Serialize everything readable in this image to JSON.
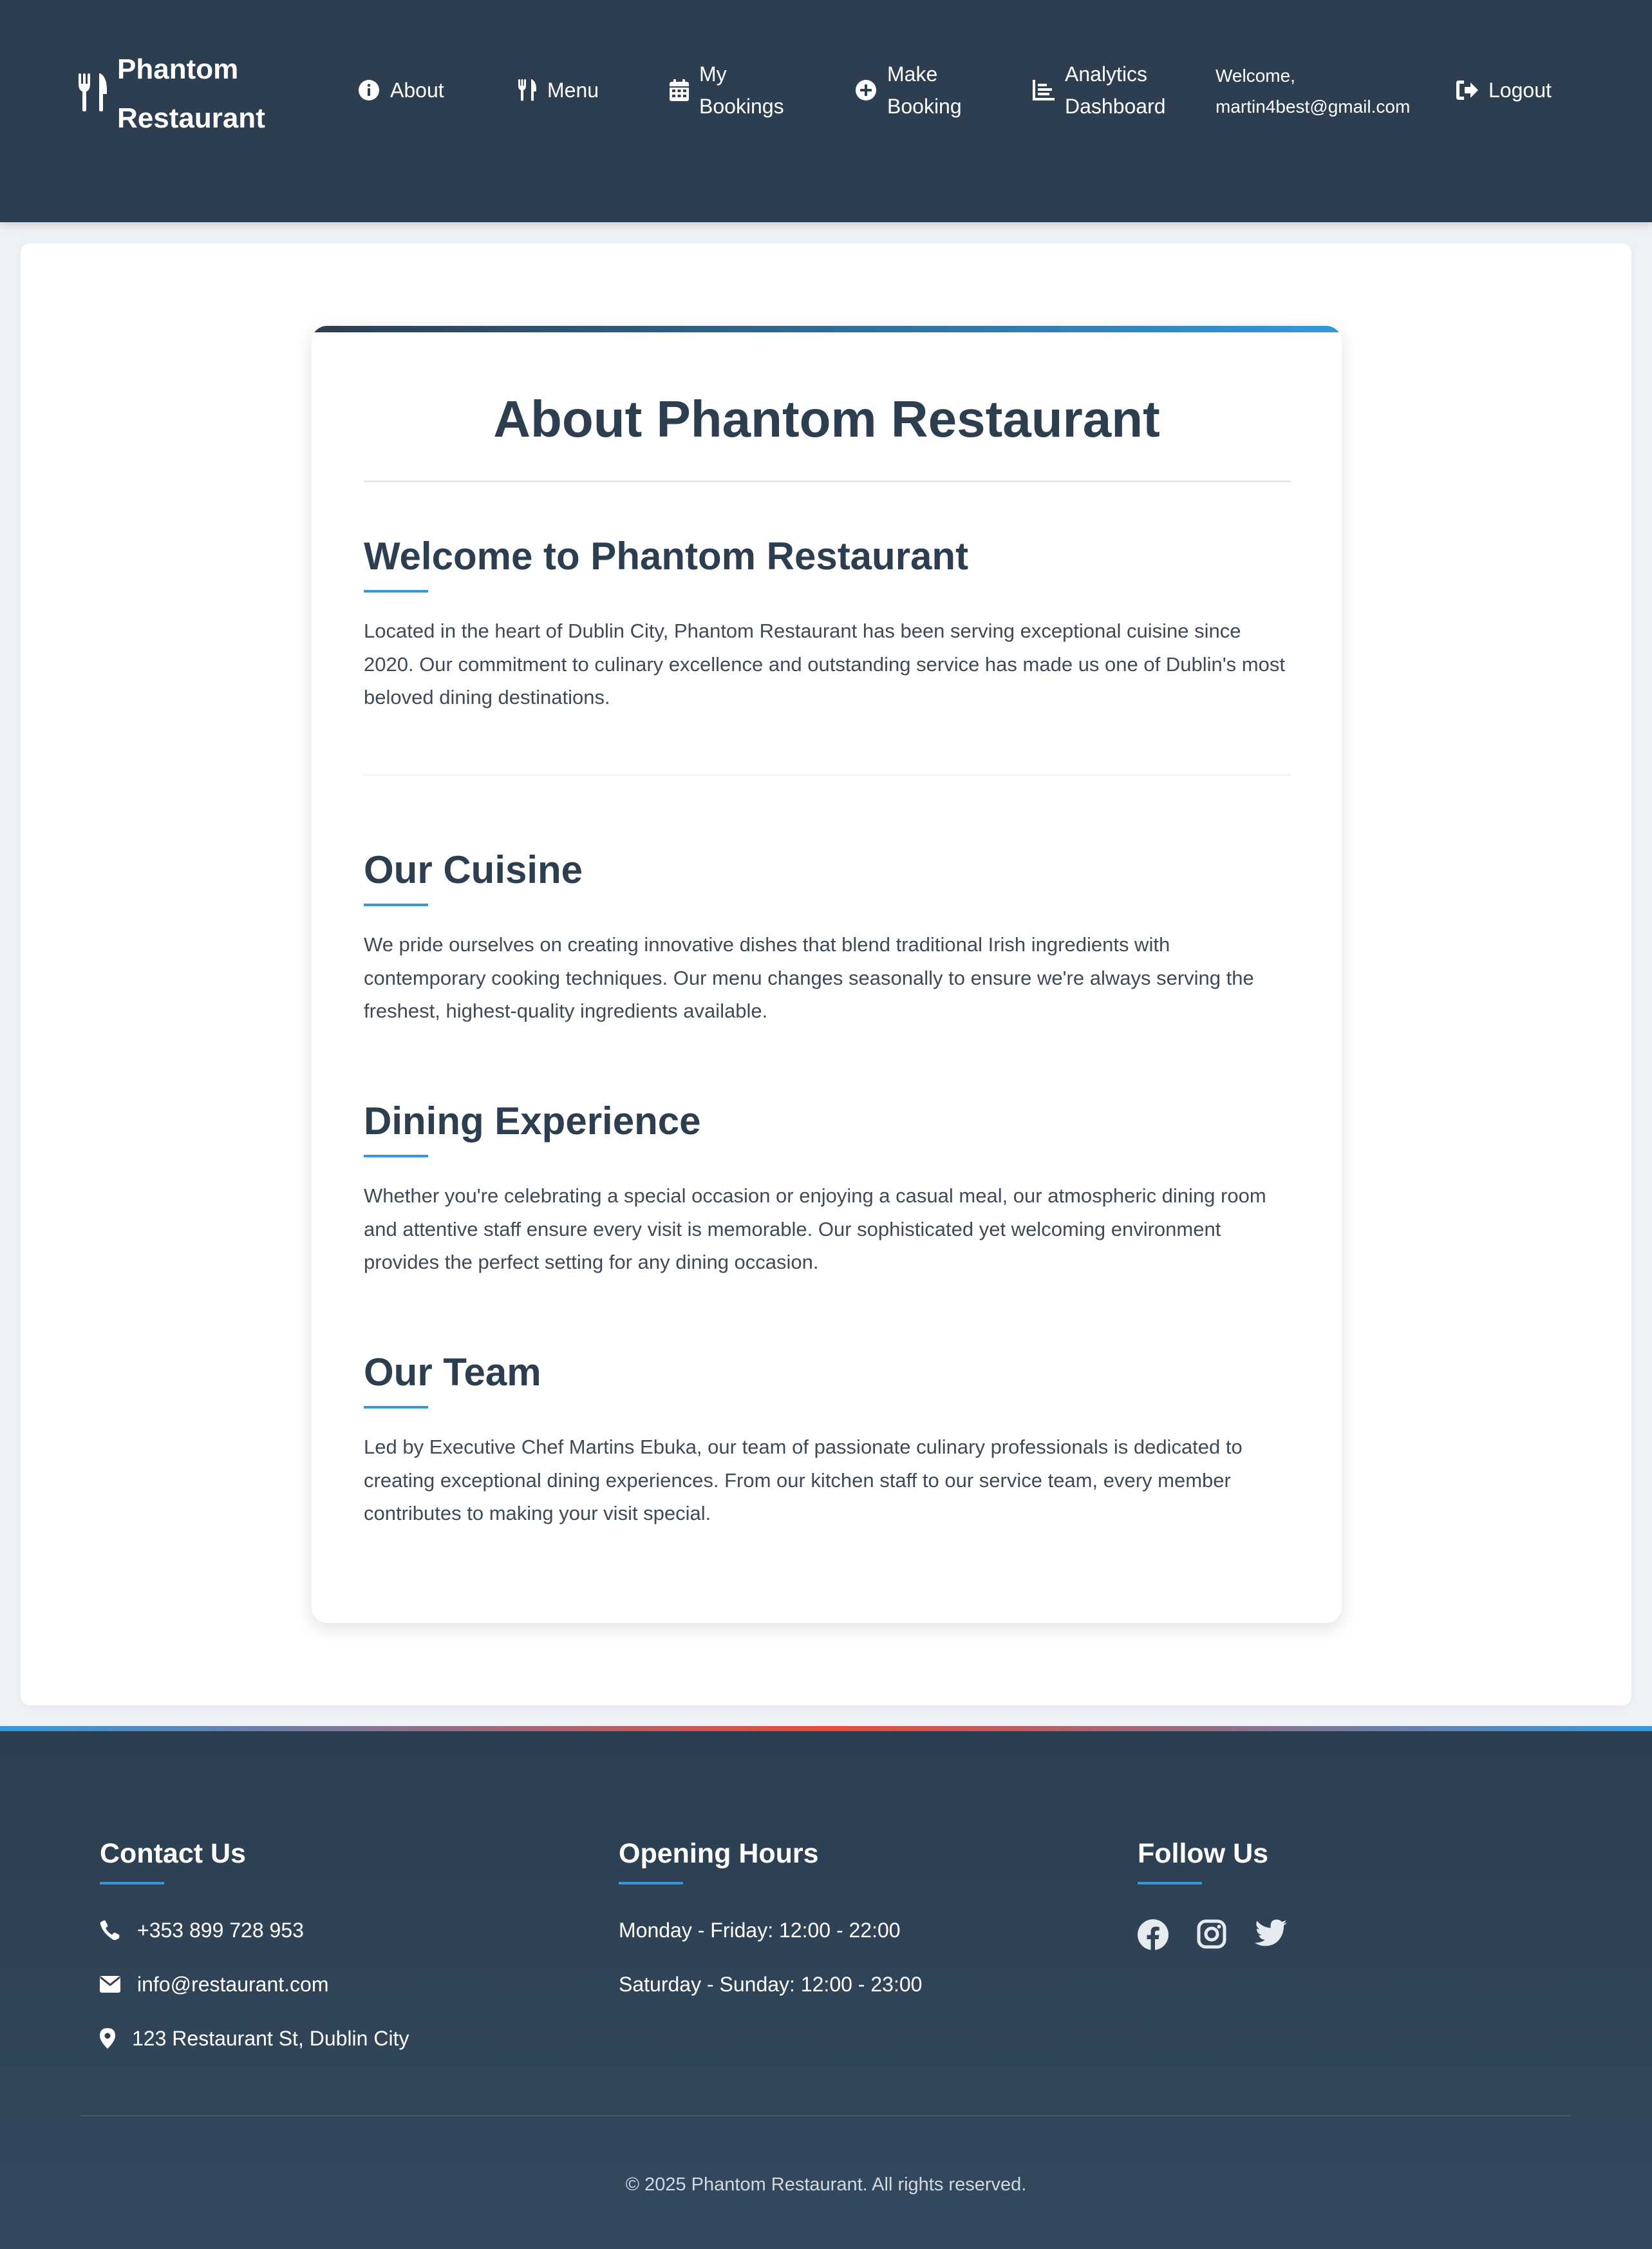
{
  "nav": {
    "brand": "Phantom Restaurant",
    "items": [
      {
        "label": "About",
        "icon": "info-circle-icon"
      },
      {
        "label": "Menu",
        "icon": "utensils-icon"
      },
      {
        "label": "My Bookings",
        "icon": "calendar-icon"
      },
      {
        "label": "Make Booking",
        "icon": "plus-circle-icon"
      },
      {
        "label": "Analytics Dashboard",
        "icon": "chart-icon"
      }
    ],
    "welcome": "Welcome, martin4best@gmail.com",
    "logout": "Logout"
  },
  "about": {
    "title": "About Phantom Restaurant",
    "sections": [
      {
        "heading": "Welcome to Phantom Restaurant",
        "text": "Located in the heart of Dublin City, Phantom Restaurant has been serving exceptional cuisine since 2020. Our commitment to culinary excellence and outstanding service has made us one of Dublin's most beloved dining destinations."
      },
      {
        "heading": "Our Cuisine",
        "text": "We pride ourselves on creating innovative dishes that blend traditional Irish ingredients with contemporary cooking techniques. Our menu changes seasonally to ensure we're always serving the freshest, highest-quality ingredients available."
      },
      {
        "heading": "Dining Experience",
        "text": "Whether you're celebrating a special occasion or enjoying a casual meal, our atmospheric dining room and attentive staff ensure every visit is memorable. Our sophisticated yet welcoming environment provides the perfect setting for any dining occasion."
      },
      {
        "heading": "Our Team",
        "text": "Led by Executive Chef Martins Ebuka, our team of passionate culinary professionals is dedicated to creating exceptional dining experiences. From our kitchen staff to our service team, every member contributes to making your visit special."
      }
    ]
  },
  "footer": {
    "contact": {
      "heading": "Contact Us",
      "phone": "+353 899 728 953",
      "email": "info@restaurant.com",
      "address": "123 Restaurant St, Dublin City"
    },
    "hours": {
      "heading": "Opening Hours",
      "weekday": "Monday - Friday: 12:00 - 22:00",
      "weekend": "Saturday - Sunday: 12:00 - 23:00"
    },
    "follow": {
      "heading": "Follow Us",
      "networks": [
        "facebook-icon",
        "instagram-icon",
        "twitter-icon"
      ]
    },
    "copyright": "© 2025 Phantom Restaurant. All rights reserved."
  },
  "colors": {
    "navy": "#2c3e50",
    "accent": "#3498db",
    "stripe_red": "#e74c3c"
  }
}
